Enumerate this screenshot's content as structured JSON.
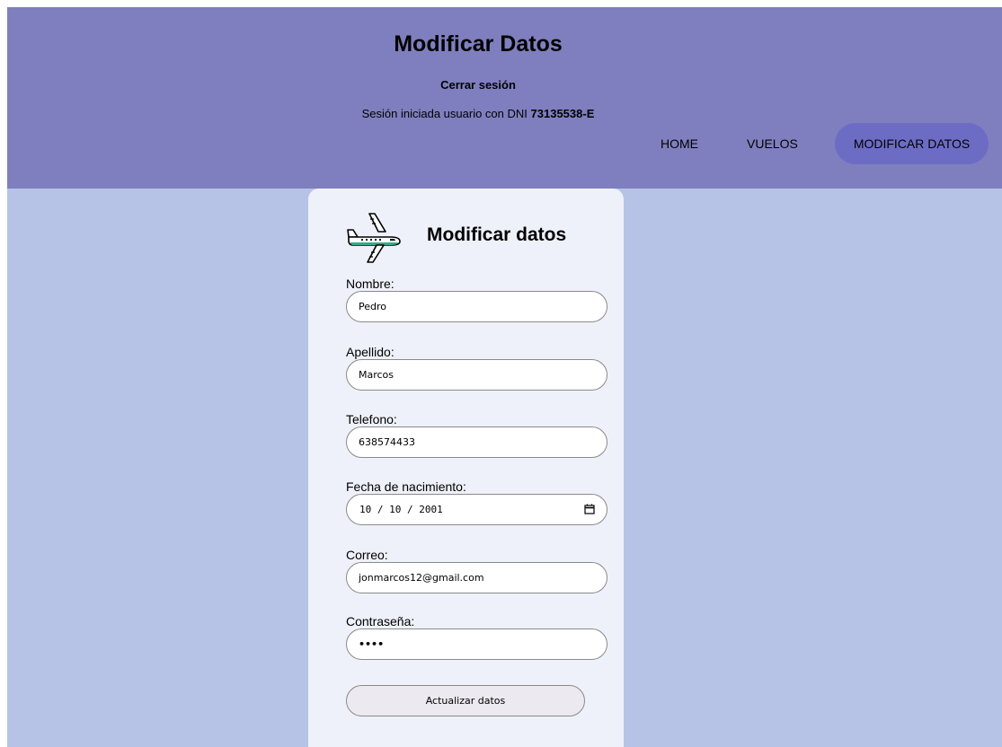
{
  "header": {
    "title": "Modificar Datos",
    "logout_label": "Cerrar sesión",
    "session_text": "Sesión iniciada usuario con DNI",
    "dni": "73135538-E"
  },
  "nav": {
    "items": [
      {
        "label": "HOME"
      },
      {
        "label": "VUELOS"
      },
      {
        "label": "MODIFICAR DATOS"
      }
    ],
    "active": "MODIFICAR DATOS"
  },
  "form": {
    "title": "Modificar datos",
    "fields": {
      "nombre": {
        "label": "Nombre:",
        "value": "Pedro"
      },
      "apellido": {
        "label": "Apellido:",
        "value": "Marcos"
      },
      "telefono": {
        "label": "Telefono:",
        "value": "638574433"
      },
      "fecha": {
        "label": "Fecha de nacimiento:",
        "value": "10 / 10 / 2001"
      },
      "correo": {
        "label": "Correo:",
        "value": "jonmarcos12@gmail.com"
      },
      "contrasena": {
        "label": "Contraseña:",
        "value": "••••"
      }
    },
    "submit_label": "Actualizar datos"
  },
  "icons": {
    "brand": "airplane-icon",
    "date_picker": "calendar-icon"
  },
  "colors": {
    "header_bg": "#7f7fbf",
    "page_bg": "#b7c3e6",
    "card_bg": "#eef1f9",
    "nav_active": "#6c6cc4",
    "plane_accent": "#3aa887"
  }
}
